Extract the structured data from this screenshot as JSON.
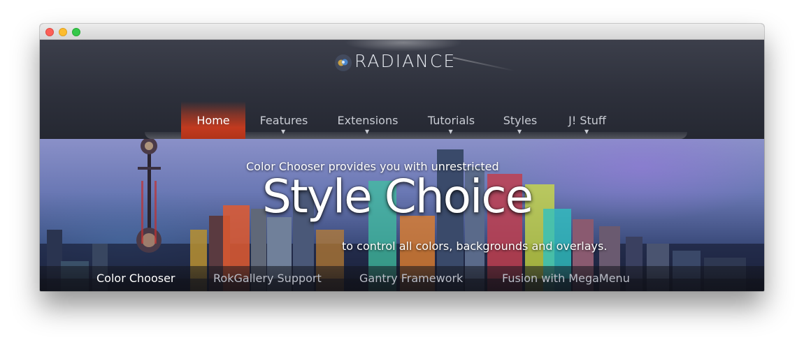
{
  "window": {
    "controls": [
      "close",
      "minimize",
      "zoom"
    ]
  },
  "header": {
    "logo_text": "RADIANCE",
    "logo_icon": "lens-flare-icon"
  },
  "nav": {
    "items": [
      {
        "label": "Home",
        "active": true,
        "has_dropdown": false
      },
      {
        "label": "Features",
        "active": false,
        "has_dropdown": true
      },
      {
        "label": "Extensions",
        "active": false,
        "has_dropdown": true
      },
      {
        "label": "Tutorials",
        "active": false,
        "has_dropdown": true
      },
      {
        "label": "Styles",
        "active": false,
        "has_dropdown": true
      },
      {
        "label": "J! Stuff",
        "active": false,
        "has_dropdown": true
      }
    ],
    "active_color": "#c23a1f"
  },
  "hero": {
    "kicker": "Color Chooser provides you with unrestricted",
    "title": "Style Choice",
    "subtitle": "to control all colors, backgrounds and overlays."
  },
  "tabs": {
    "items": [
      {
        "label": "Color Chooser",
        "active": true
      },
      {
        "label": "RokGallery Support",
        "active": false
      },
      {
        "label": "Gantry Framework",
        "active": false
      },
      {
        "label": "Fusion with MegaMenu",
        "active": false
      }
    ]
  }
}
